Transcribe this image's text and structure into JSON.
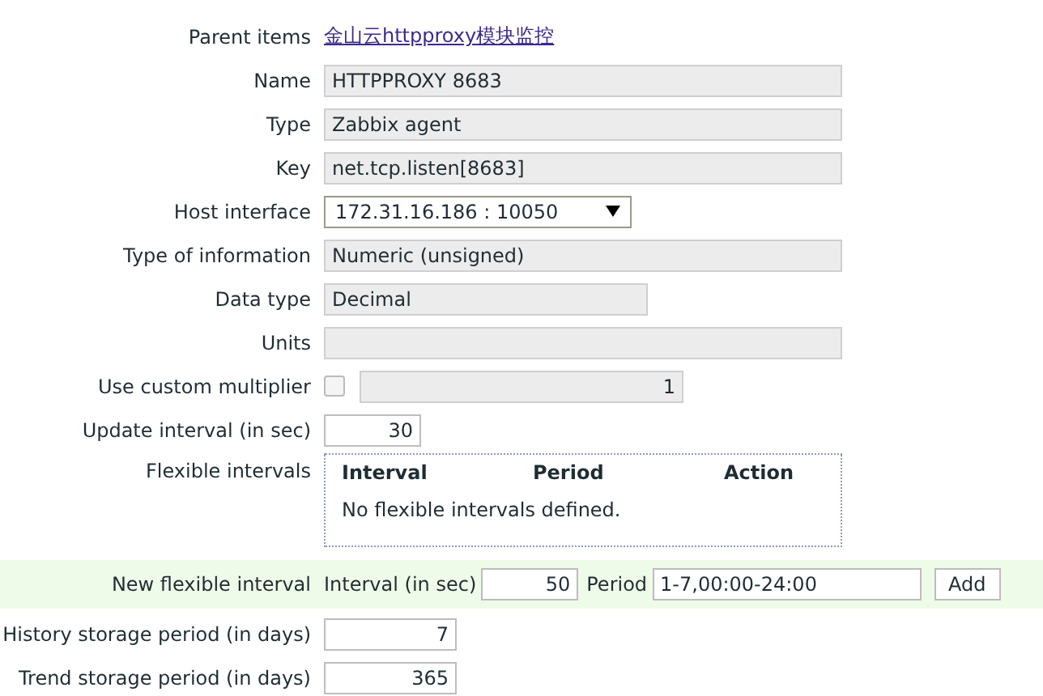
{
  "form": {
    "rows": [
      {
        "kind": "link",
        "label": "Parent items",
        "value": "金山云httpproxy模块监控"
      },
      {
        "kind": "text-wide",
        "label": "Name",
        "value": "HTTPPROXY 8683",
        "readonly": true
      },
      {
        "kind": "text-wide",
        "label": "Type",
        "value": "Zabbix agent",
        "readonly": true
      },
      {
        "kind": "text-wide",
        "label": "Key",
        "value": "net.tcp.listen[8683]",
        "readonly": true
      },
      {
        "kind": "select",
        "label": "Host interface",
        "value": "172.31.16.186 : 10050"
      },
      {
        "kind": "text-wide",
        "label": "Type of information",
        "value": "Numeric (unsigned)",
        "readonly": true
      },
      {
        "kind": "text-medium",
        "label": "Data type",
        "value": "Decimal",
        "readonly": true
      },
      {
        "kind": "text-wide",
        "label": "Units",
        "readonly": true
      },
      {
        "kind": "multiplier",
        "label": "Use custom multiplier",
        "checked": false,
        "value": "1",
        "readonly": true
      },
      {
        "kind": "number",
        "label": "Update interval (in sec)",
        "value": "30",
        "readonly": false
      },
      {
        "kind": "intervals",
        "label": "Flexible intervals",
        "columns": [
          "Interval",
          "Period",
          "Action"
        ],
        "empty": "No flexible intervals defined."
      },
      {
        "kind": "new-interval",
        "label": "New flexible interval",
        "interval_label": "Interval (in sec)",
        "interval": "50",
        "period_label": "Period",
        "period": "1-7,00:00-24:00",
        "button": "Add"
      },
      {
        "kind": "number",
        "label": "History storage period (in days)",
        "value": "7",
        "readonly": false
      },
      {
        "kind": "number",
        "label": "Trend storage period (in days)",
        "value": "365",
        "readonly": false
      }
    ]
  }
}
